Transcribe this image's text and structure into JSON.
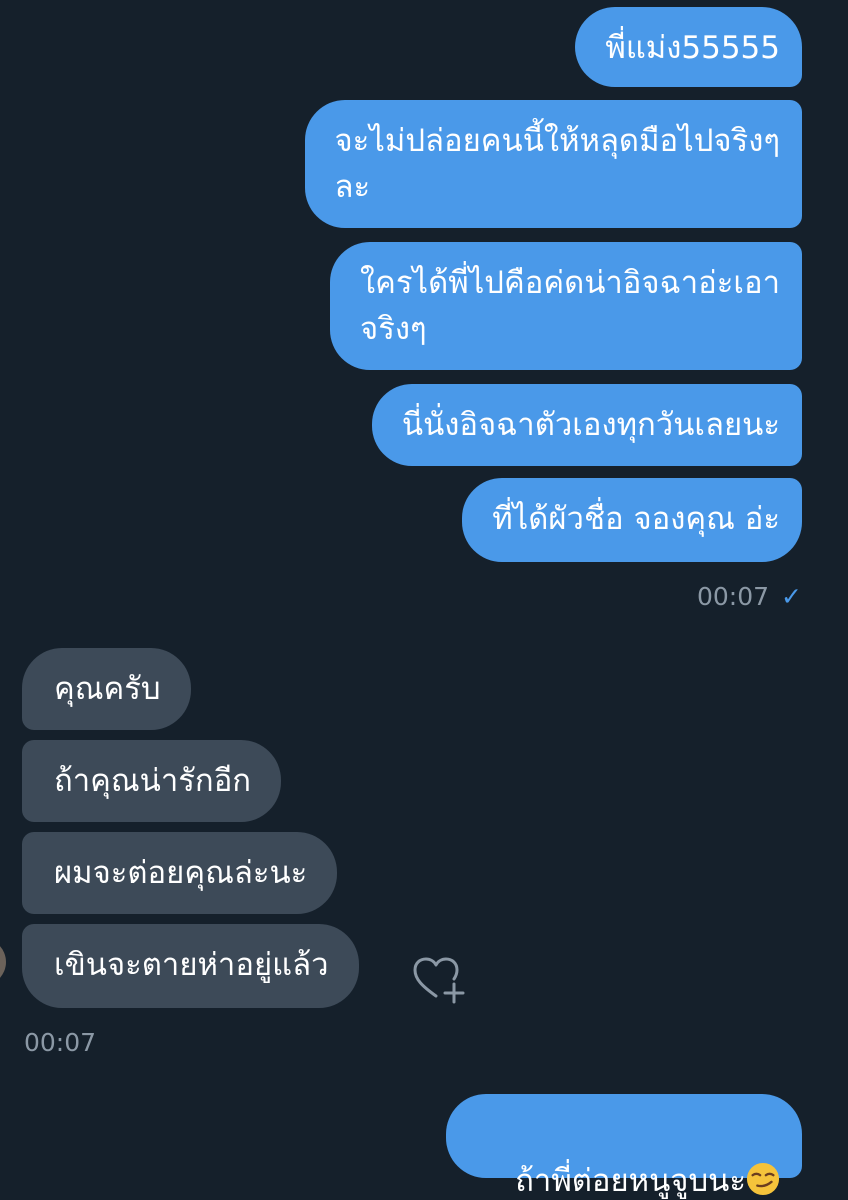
{
  "messages_out_1": [
    {
      "text": "พี่แม่ง55555"
    },
    {
      "text": "จะไม่ปล่อยคนนี้ให้หลุดมือไปจริงๆ\nละ"
    },
    {
      "text": "ใครได้พี่ไปคือค่ดน่าอิจฉาอ่ะเอา\nจริงๆ"
    },
    {
      "text": "นี่นั่งอิจฉาตัวเองทุกวันเลยนะ"
    },
    {
      "text": "ที่ได้ผัวชื่อ จองคุณ อ่ะ"
    }
  ],
  "time_out_1": "00:07",
  "read_mark": "✓",
  "messages_in": [
    {
      "text": "คุณครับ"
    },
    {
      "text": "ถ้าคุณน่ารักอีก"
    },
    {
      "text": "ผมจะต่อยคุณล่ะนะ"
    },
    {
      "text": "เขินจะตายห่าอยู่แล้ว"
    }
  ],
  "time_in": "00:07",
  "messages_out_2": [
    {
      "text": "ถ้าพี่ต่อยหนูจูบนะ",
      "emoji": "smirking-face"
    }
  ],
  "colors": {
    "background": "#15202b",
    "outgoing_bubble": "#4a99e9",
    "incoming_bubble": "#3d4a58",
    "timestamp": "#8b98a5"
  }
}
